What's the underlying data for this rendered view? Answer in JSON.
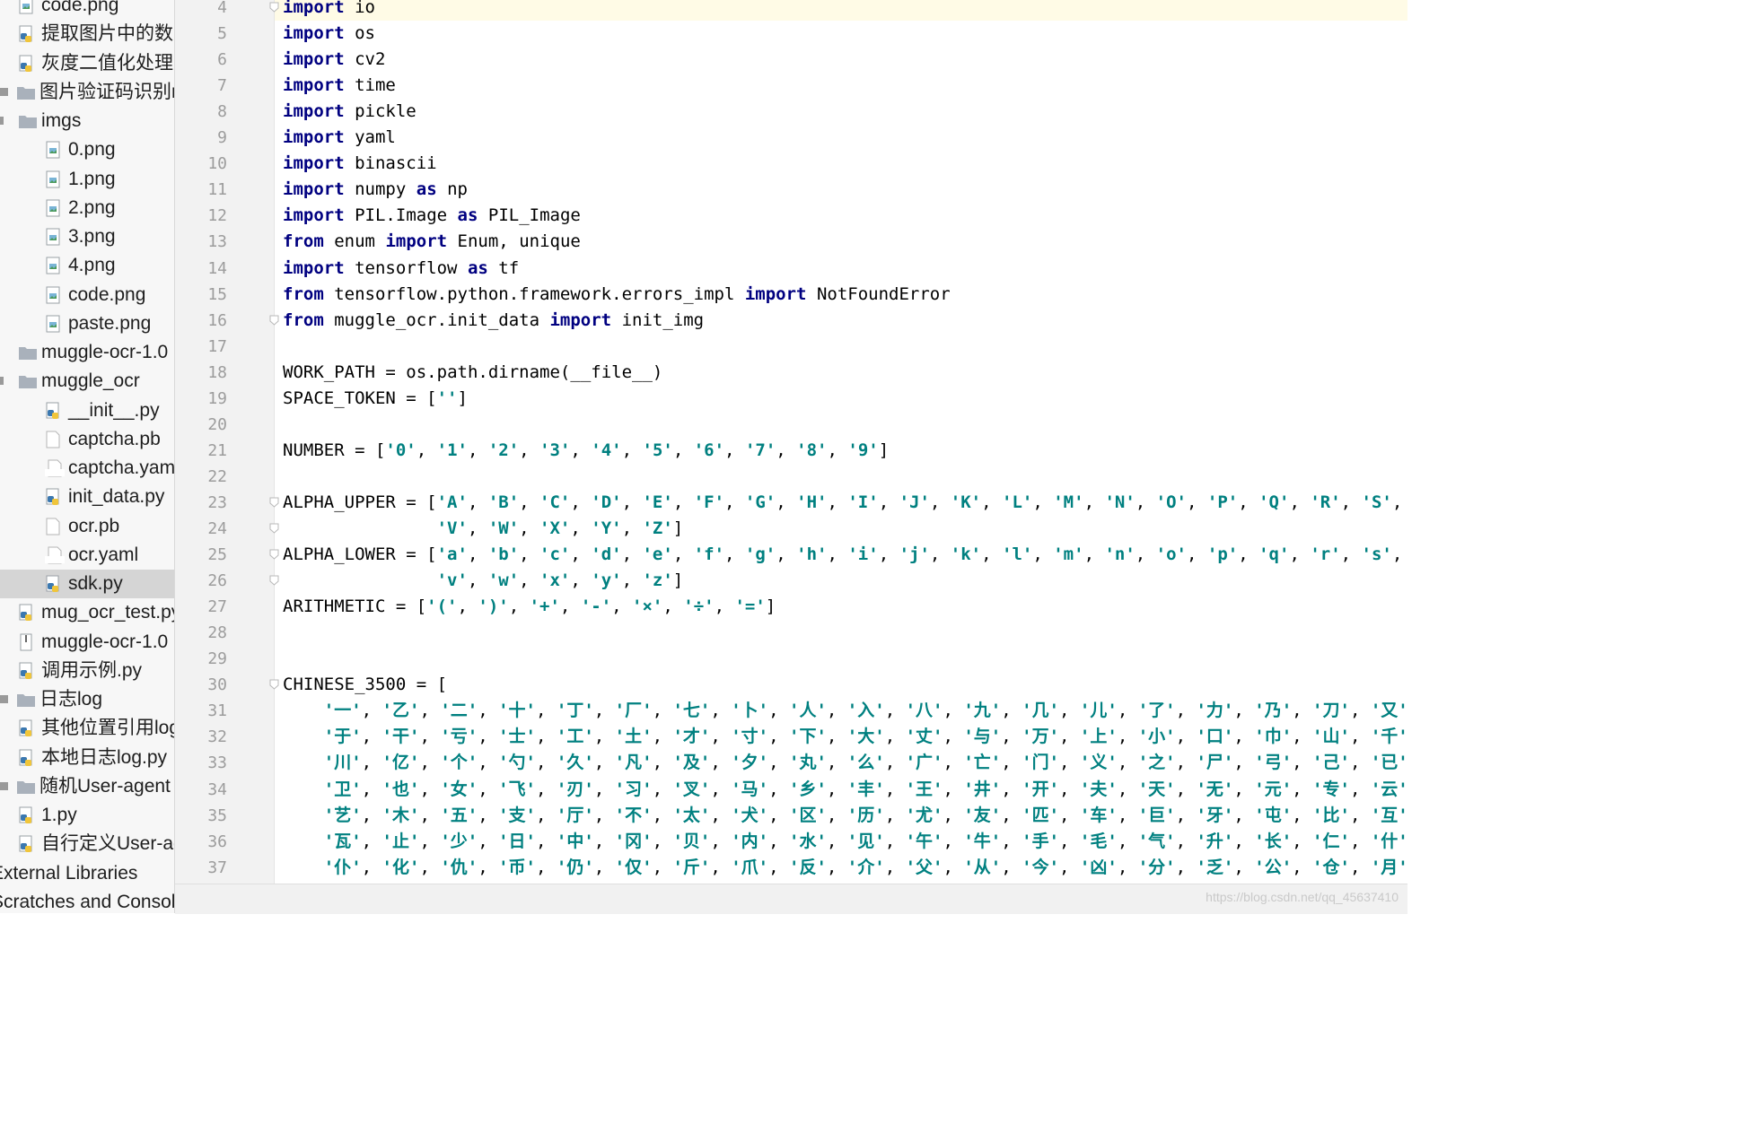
{
  "project_tree": [
    {
      "label": "code.png",
      "type": "image"
    },
    {
      "label": "提取图片中的数",
      "type": "python"
    },
    {
      "label": "灰度二值化处理",
      "type": "python"
    },
    {
      "label": "图片验证码识别mu",
      "type": "folder"
    },
    {
      "label": "imgs",
      "type": "folder"
    },
    {
      "label": "0.png",
      "type": "image"
    },
    {
      "label": "1.png",
      "type": "image"
    },
    {
      "label": "2.png",
      "type": "image"
    },
    {
      "label": "3.png",
      "type": "image"
    },
    {
      "label": "4.png",
      "type": "image"
    },
    {
      "label": "code.png",
      "type": "image"
    },
    {
      "label": "paste.png",
      "type": "image"
    },
    {
      "label": "muggle-ocr-1.0",
      "type": "folder"
    },
    {
      "label": "muggle_ocr",
      "type": "folder"
    },
    {
      "label": "__init__.py",
      "type": "python"
    },
    {
      "label": "captcha.pb",
      "type": "file"
    },
    {
      "label": "captcha.yaml",
      "type": "yaml"
    },
    {
      "label": "init_data.py",
      "type": "python"
    },
    {
      "label": "ocr.pb",
      "type": "file"
    },
    {
      "label": "ocr.yaml",
      "type": "yaml"
    },
    {
      "label": "sdk.py",
      "type": "python",
      "selected": true
    },
    {
      "label": "mug_ocr_test.py",
      "type": "python"
    },
    {
      "label": "muggle-ocr-1.0",
      "type": "archive"
    },
    {
      "label": "调用示例.py",
      "type": "python"
    },
    {
      "label": "日志log",
      "type": "folder"
    },
    {
      "label": "其他位置引用log",
      "type": "python"
    },
    {
      "label": "本地日志log.py",
      "type": "python"
    },
    {
      "label": "随机User-agent",
      "type": "folder"
    },
    {
      "label": "1.py",
      "type": "python"
    },
    {
      "label": "自行定义User-agent",
      "type": "python"
    },
    {
      "label": "External Libraries",
      "type": "library"
    },
    {
      "label": "Scratches and Consoles",
      "type": "scratch"
    }
  ],
  "line_numbers": [
    "4",
    "5",
    "6",
    "7",
    "8",
    "9",
    "10",
    "11",
    "12",
    "13",
    "14",
    "15",
    "16",
    "17",
    "18",
    "19",
    "20",
    "21",
    "22",
    "23",
    "24",
    "25",
    "26",
    "27",
    "28",
    "29",
    "30",
    "31",
    "32",
    "33",
    "34",
    "35",
    "36",
    "37"
  ],
  "code_lines": [
    "import io",
    "import os",
    "import cv2",
    "import time",
    "import pickle",
    "import yaml",
    "import binascii",
    "import numpy as np",
    "import PIL.Image as PIL_Image",
    "from enum import Enum, unique",
    "import tensorflow as tf",
    "from tensorflow.python.framework.errors_impl import NotFoundError",
    "from muggle_ocr.init_data import init_img",
    "",
    "WORK_PATH = os.path.dirname(__file__)",
    "SPACE_TOKEN = ['']",
    "",
    "NUMBER = ['0', '1', '2', '3', '4', '5', '6', '7', '8', '9']",
    "",
    "ALPHA_UPPER = ['A', 'B', 'C', 'D', 'E', 'F', 'G', 'H', 'I', 'J', 'K', 'L', 'M', 'N', 'O', 'P', 'Q', 'R', 'S', 'T', 'U',",
    "               'V', 'W', 'X', 'Y', 'Z']",
    "ALPHA_LOWER = ['a', 'b', 'c', 'd', 'e', 'f', 'g', 'h', 'i', 'j', 'k', 'l', 'm', 'n', 'o', 'p', 'q', 'r', 's', 't', 'u',",
    "               'v', 'w', 'x', 'y', 'z']",
    "ARITHMETIC = ['(', ')', '+', '-', '×', '÷', '=']",
    "",
    "",
    "CHINESE_3500 = [",
    "    '一', '乙', '二', '十', '丁', '厂', '七', '卜', '人', '入', '八', '九', '几', '儿', '了', '力', '乃', '刀', '又',",
    "    '于', '干', '亏', '士', '工', '土', '才', '寸', '下', '大', '丈', '与', '万', '上', '小', '口', '巾', '山', '千',",
    "    '川', '亿', '个', '勺', '久', '凡', '及', '夕', '丸', '么', '广', '亡', '门', '义', '之', '尸', '弓', '己', '已',",
    "    '卫', '也', '女', '飞', '刃', '习', '叉', '马', '乡', '丰', '王', '井', '开', '夫', '天', '无', '元', '专', '云',",
    "    '艺', '木', '五', '支', '厅', '不', '太', '犬', '区', '历', '尤', '友', '匹', '车', '巨', '牙', '屯', '比', '互',",
    "    '瓦', '止', '少', '日', '中', '冈', '贝', '内', '水', '见', '午', '牛', '手', '毛', '气', '升', '长', '仁', '什',",
    "    '仆', '化', '仇', '币', '仍', '仅', '斤', '爪', '反', '介', '父', '从', '今', '凶', '分', '乏', '公', '仓', '月'"
  ],
  "fold_markers_at_lines": [
    "4",
    "16",
    "23",
    "24",
    "25",
    "26",
    "30"
  ],
  "watermark": "https://blog.csdn.net/qq_45637410",
  "colors": {
    "keyword": "#000080",
    "string": "#008080",
    "line_number": "#9c9c9c",
    "selected_row": "#d5d5d5"
  }
}
